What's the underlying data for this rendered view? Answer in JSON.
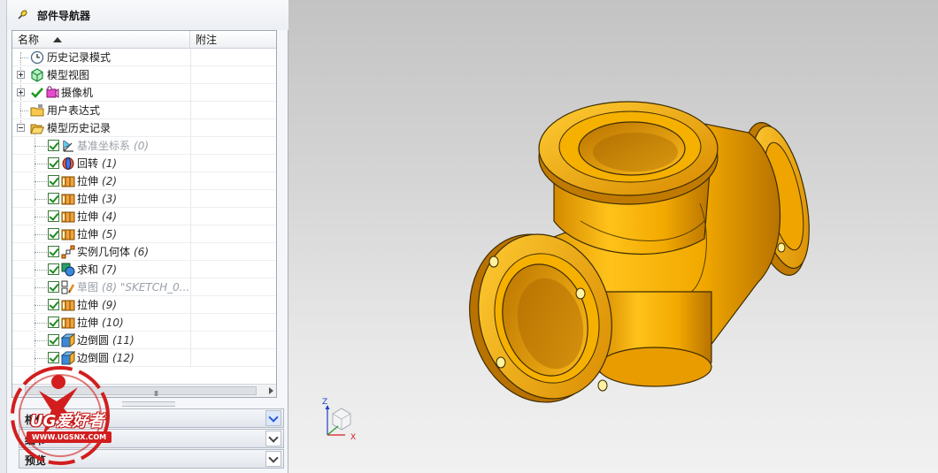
{
  "navigator": {
    "title": "部件导航器",
    "columns": {
      "name": "名称",
      "note": "附注"
    },
    "items": [
      {
        "label": "历史记录模式",
        "number": "",
        "icon": "history-clock-icon"
      },
      {
        "label": "模型视图",
        "number": "",
        "icon": "model-views-icon"
      },
      {
        "label": "摄像机",
        "number": "",
        "icon": "camera-icon"
      },
      {
        "label": "用户表达式",
        "number": "",
        "icon": "expressions-folder-icon"
      },
      {
        "label": "模型历史记录",
        "number": "",
        "icon": "folder-open-icon"
      },
      {
        "label": "基准坐标系",
        "number": "(0)",
        "icon": "datum-csys-icon"
      },
      {
        "label": "回转",
        "number": "(1)",
        "icon": "revolve-icon"
      },
      {
        "label": "拉伸",
        "number": "(2)",
        "icon": "extrude-icon"
      },
      {
        "label": "拉伸",
        "number": "(3)",
        "icon": "extrude-icon"
      },
      {
        "label": "拉伸",
        "number": "(4)",
        "icon": "extrude-icon"
      },
      {
        "label": "拉伸",
        "number": "(5)",
        "icon": "extrude-icon"
      },
      {
        "label": "实例几何体",
        "number": "(6)",
        "icon": "instance-geometry-icon"
      },
      {
        "label": "求和",
        "number": "(7)",
        "icon": "unite-icon"
      },
      {
        "label": "草图",
        "number": "(8) \"SKETCH_0...",
        "icon": "sketch-icon"
      },
      {
        "label": "拉伸",
        "number": "(9)",
        "icon": "extrude-icon"
      },
      {
        "label": "拉伸",
        "number": "(10)",
        "icon": "extrude-icon"
      },
      {
        "label": "边倒圆",
        "number": "(11)",
        "icon": "edge-blend-icon"
      },
      {
        "label": "边倒圆",
        "number": "(12)",
        "icon": "edge-blend-icon"
      }
    ],
    "scroll_grip": "III"
  },
  "sections": {
    "dependencies": "相依性",
    "details": "细节",
    "preview": "预览"
  },
  "triad": {
    "z": "Z",
    "x": "X"
  },
  "watermark": {
    "brand": "UG爱好者",
    "site": "WWW.UGSNX.COM"
  },
  "colors": {
    "model_orange": "#f2a900",
    "model_edge": "#3d2c00",
    "check_green": "#1e8a1e",
    "watermark_red": "#d21e1e"
  }
}
